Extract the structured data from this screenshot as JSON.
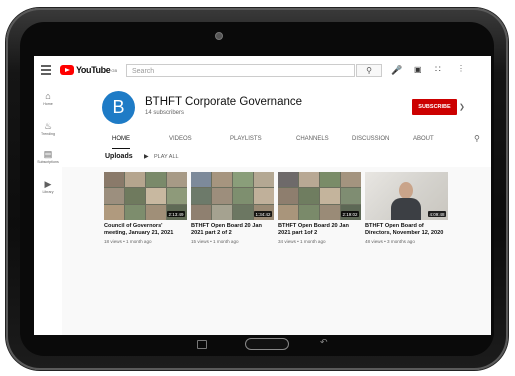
{
  "topbar": {
    "logo_text": "YouTube",
    "logo_region": "GB",
    "search_placeholder": "Search",
    "search_icon": "search-icon",
    "mic_icon": "mic-icon",
    "create_icon": "video-camera-icon",
    "apps_icon": "apps-grid-icon",
    "more_icon": "more-vert-icon"
  },
  "sidebar": {
    "items": [
      {
        "label": "Home",
        "icon": "home-icon"
      },
      {
        "label": "Trending",
        "icon": "fire-icon"
      },
      {
        "label": "Subscriptions",
        "icon": "subscriptions-icon"
      },
      {
        "label": "Library",
        "icon": "library-icon"
      }
    ]
  },
  "channel": {
    "avatar_letter": "B",
    "name": "BTHFT Corporate Governance",
    "subscribers": "14 subscribers",
    "subscribe_label": "SUBSCRIBE",
    "avatar_color": "#1e7bc6",
    "subscribe_color": "#cc0000"
  },
  "tabs": [
    {
      "label": "HOME",
      "active": true
    },
    {
      "label": "VIDEOS",
      "active": false
    },
    {
      "label": "PLAYLISTS",
      "active": false
    },
    {
      "label": "CHANNELS",
      "active": false
    },
    {
      "label": "DISCUSSION",
      "active": false
    },
    {
      "label": "ABOUT",
      "active": false
    }
  ],
  "uploads": {
    "title": "Uploads",
    "play_all": "PLAY ALL"
  },
  "videos": [
    {
      "title_line1": "Council of Governors'",
      "title_line2": "meeting, January 21, 2021",
      "meta": "18 views • 1 month ago",
      "duration": "2:13:49",
      "watched": 0.0
    },
    {
      "title_line1": "BTHFT Open Board 20 Jan",
      "title_line2": "2021 part 2 of 2",
      "meta": "15 views • 1 month ago",
      "duration": "1:34:42",
      "watched": 0.0
    },
    {
      "title_line1": "BTHFT Open Board 20 Jan",
      "title_line2": "2021 part 1of 2",
      "meta": "34 views • 1 month ago",
      "duration": "2:19:02",
      "watched": 0.0
    },
    {
      "title_line1": "BTHFT Open Board of",
      "title_line2": "Directors, November 12, 2020",
      "meta": "48 views • 3 months ago",
      "duration": "4:09:48",
      "watched": 0.0
    }
  ]
}
